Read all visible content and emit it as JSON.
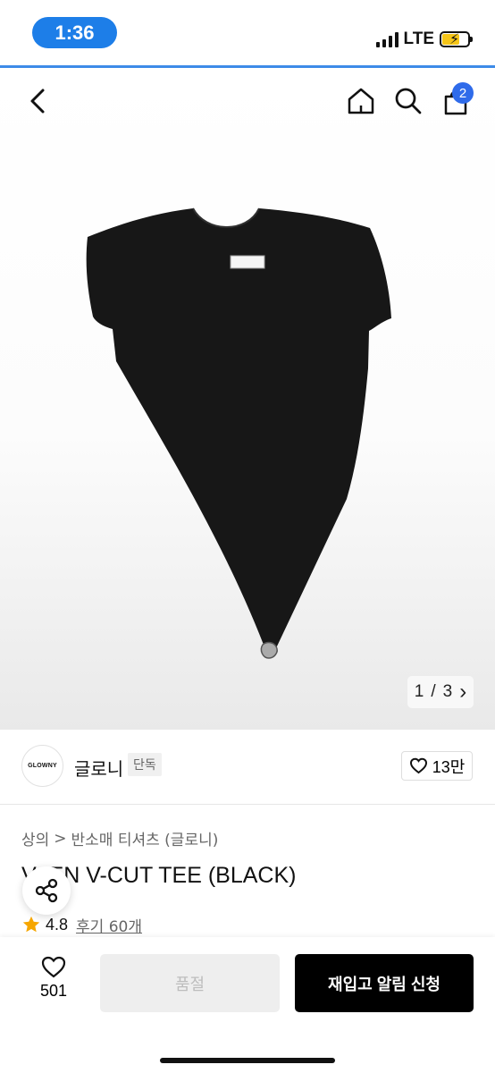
{
  "status": {
    "time": "1:36",
    "network": "LTE",
    "battery_charging": true,
    "accent_color": "#1d7ee8"
  },
  "top_nav": {
    "cart_badge": "2",
    "icons": [
      "back-icon",
      "home-icon",
      "search-icon",
      "bag-icon"
    ]
  },
  "gallery": {
    "pager_current": "1",
    "pager_separator": "/",
    "pager_total": "3",
    "pager_arrow": "›"
  },
  "brand": {
    "logo_text": "GLOWNY",
    "name": "글로니",
    "exclusive_label": "단독",
    "likes": "13만"
  },
  "breadcrumb": {
    "category_1": "상의",
    "separator": ">",
    "category_2": "반소매 티셔츠 (글로니)"
  },
  "product": {
    "title": "V-    EN V-CUT TEE (BLACK)",
    "rating": "4.8",
    "reviews": "후기 60개"
  },
  "bottom_bar": {
    "wish_count": "501",
    "sold_out_label": "품절",
    "restock_label": "재입고 알림 신청"
  }
}
